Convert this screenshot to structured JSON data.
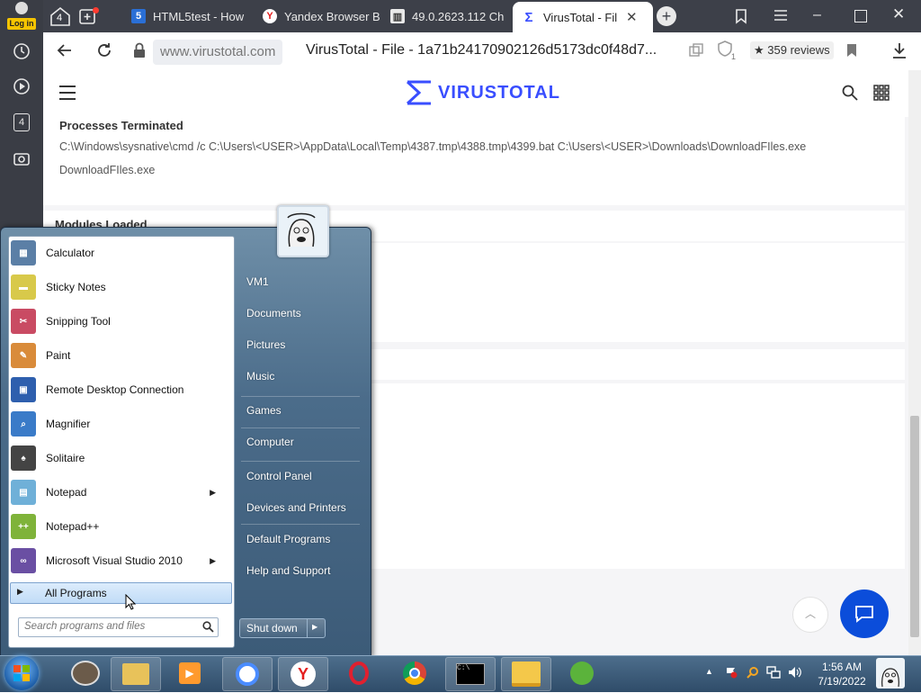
{
  "rail": {
    "login_label": "Log in",
    "tab_count": "4",
    "notif_count": "4"
  },
  "tabs": [
    {
      "label": "HTML5test - How",
      "fav": "5"
    },
    {
      "label": "Yandex Browser B",
      "fav": "Y"
    },
    {
      "label": "49.0.2623.112 Ch",
      "fav": "▥"
    },
    {
      "label": "VirusTotal - Fil",
      "fav": "Σ"
    }
  ],
  "address": {
    "domain": "www.virustotal.com",
    "title": "VirusTotal - File - 1a71b24170902126d5173dc0f48d7...",
    "reviews": "★ 359 reviews",
    "ext_count": "1"
  },
  "vt": {
    "brand": "VIRUSTOTAL",
    "processes_title": "Processes Terminated",
    "process_1": "C:\\Windows\\sysnative\\cmd /c C:\\Users\\<USER>\\AppData\\Local\\Temp\\4387.tmp\\4388.tmp\\4399.bat C:\\Users\\<USER>\\Downloads\\DownloadFIles.exe",
    "process_2": "DownloadFIles.exe",
    "modules_title": "Modules Loaded"
  },
  "start_menu": {
    "programs": [
      {
        "label": "Calculator",
        "color": "#5b7fa6",
        "glyph": "▦",
        "submenu": false
      },
      {
        "label": "Sticky Notes",
        "color": "#d8c94a",
        "glyph": "▬",
        "submenu": false
      },
      {
        "label": "Snipping Tool",
        "color": "#c94b63",
        "glyph": "✂",
        "submenu": false
      },
      {
        "label": "Paint",
        "color": "#d98b3a",
        "glyph": "✎",
        "submenu": false
      },
      {
        "label": "Remote Desktop Connection",
        "color": "#2e5fae",
        "glyph": "▣",
        "submenu": false
      },
      {
        "label": "Magnifier",
        "color": "#3a7bc8",
        "glyph": "⌕",
        "submenu": false
      },
      {
        "label": "Solitaire",
        "color": "#444444",
        "glyph": "♠",
        "submenu": false
      },
      {
        "label": "Notepad",
        "color": "#6fb0d8",
        "glyph": "▤",
        "submenu": true
      },
      {
        "label": "Notepad++",
        "color": "#7fb33a",
        "glyph": "++",
        "submenu": false
      },
      {
        "label": "Microsoft Visual Studio 2010",
        "color": "#6a4fa3",
        "glyph": "∞",
        "submenu": true
      }
    ],
    "all_programs": "All Programs",
    "search_placeholder": "Search programs and files",
    "right_links": [
      "VM1",
      "Documents",
      "Pictures",
      "Music",
      "Games",
      "Computer",
      "Control Panel",
      "Devices and Printers",
      "Default Programs",
      "Help and Support"
    ],
    "shutdown": "Shut down"
  },
  "taskbar": {
    "time": "1:56 AM",
    "date": "7/19/2022"
  },
  "colors": {
    "vt_blue": "#394EFF",
    "chat_blue": "#0b4dda"
  }
}
